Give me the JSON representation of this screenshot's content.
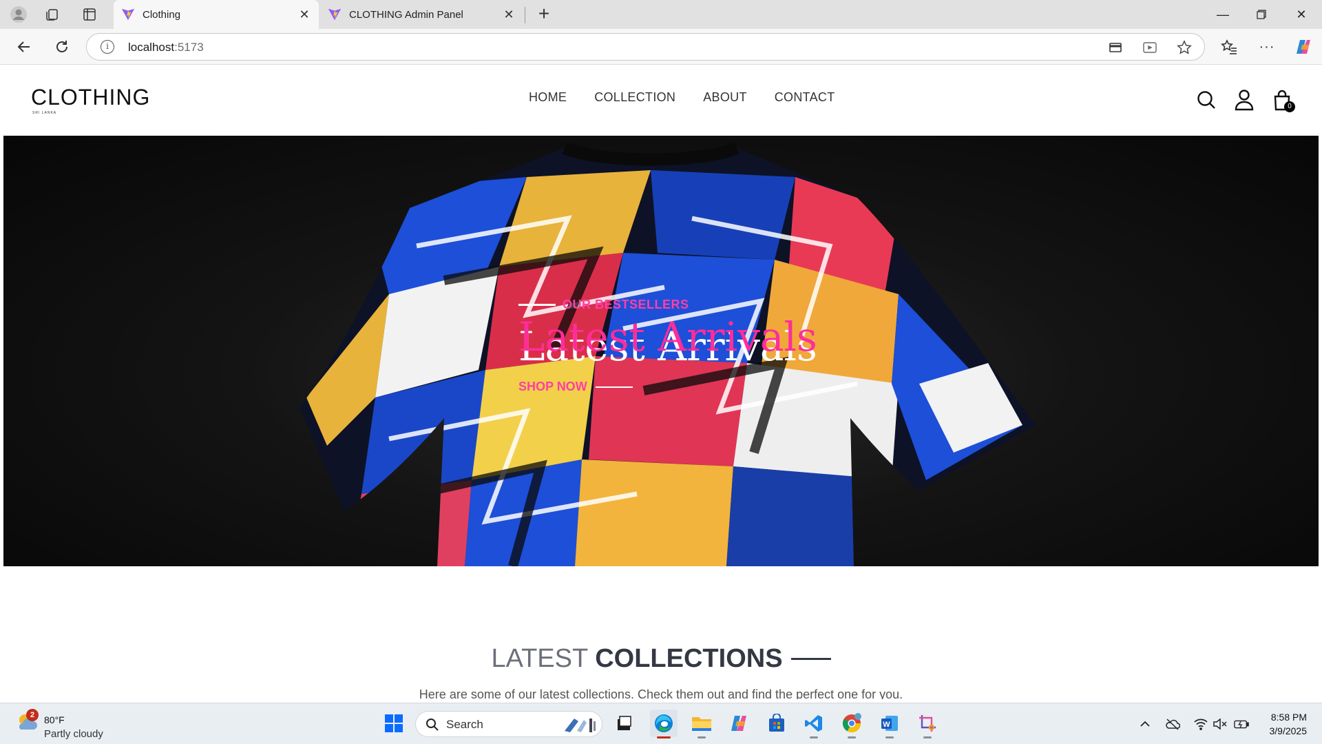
{
  "browser": {
    "tabs": [
      {
        "title": "Clothing",
        "active": true
      },
      {
        "title": "CLOTHING Admin Panel",
        "active": false
      }
    ],
    "url_host": "localhost",
    "url_port": ":5173"
  },
  "site": {
    "logo_text": "CLOTHING",
    "logo_subtext": "SRI LANKA",
    "nav": [
      "HOME",
      "COLLECTION",
      "ABOUT",
      "CONTACT"
    ],
    "cart_count": "0",
    "hero": {
      "kicker": "OUR BESTSELLERS",
      "title": "Latest Arrivals",
      "cta": "SHOP NOW"
    },
    "collections": {
      "title_light": "LATEST",
      "title_bold": "COLLECTIONS",
      "subtitle": "Here are some of our latest collections. Check them out and find the perfect one for you."
    }
  },
  "taskbar": {
    "weather_badge": "2",
    "weather_temp": "80°F",
    "weather_desc": "Partly cloudy",
    "search_label": "Search",
    "time": "8:58 PM",
    "date": "3/9/2025"
  },
  "colors": {
    "accent_pink": "#ff2d9a",
    "hero_bg": "#0a0a0a",
    "heading_dark": "#333843"
  }
}
